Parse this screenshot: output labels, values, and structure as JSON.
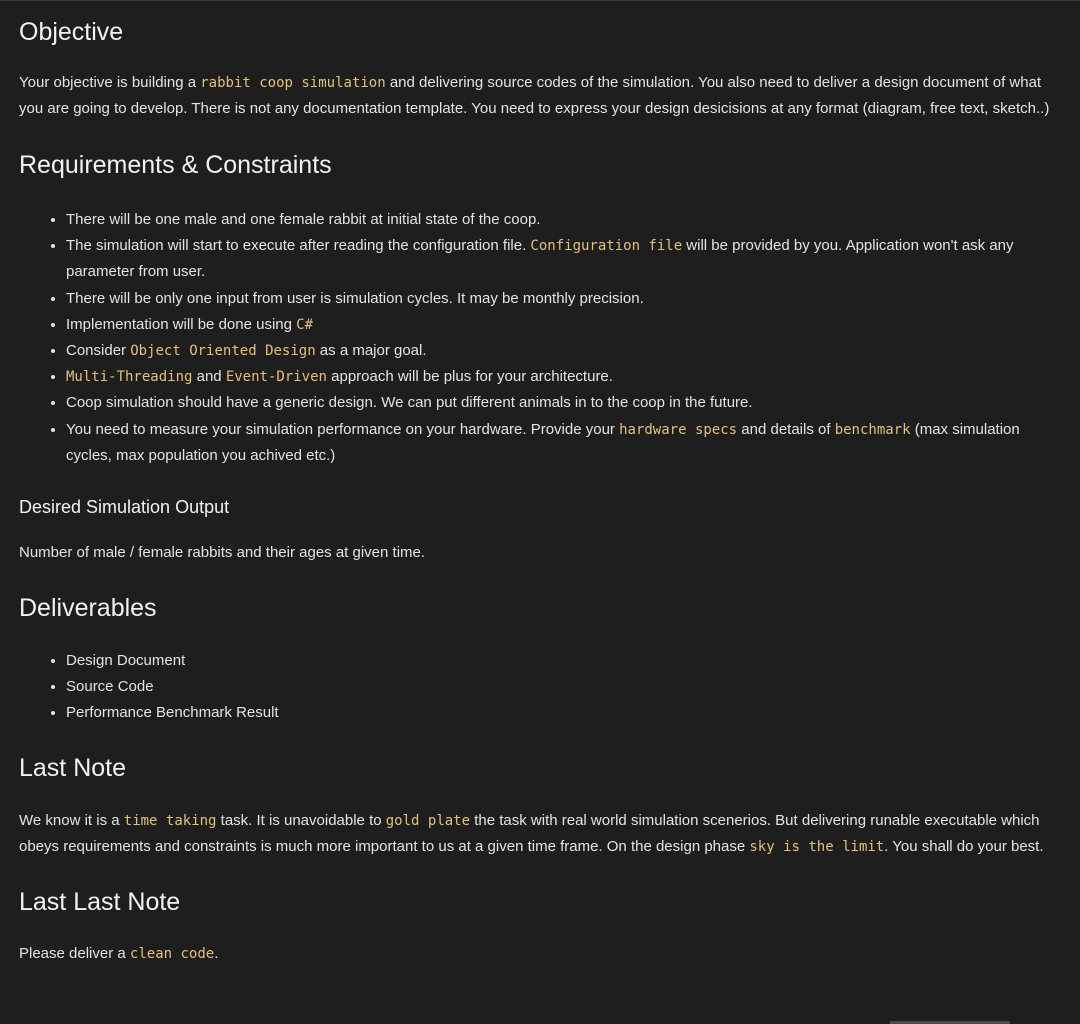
{
  "sections": {
    "objective": {
      "title": "Objective",
      "segments": [
        {
          "t": "Your objective is building a "
        },
        {
          "t": "rabbit coop simulation",
          "code": true
        },
        {
          "t": " and delivering source codes of the simulation. You also need to deliver a design document of what you are going to develop. There is not any documentation template. You need to express your design desicisions at any format (diagram, free text, sketch..)"
        }
      ]
    },
    "requirements": {
      "title": "Requirements & Constraints",
      "items": [
        [
          {
            "t": "There will be one male and one female rabbit at initial state of the coop."
          }
        ],
        [
          {
            "t": "The simulation will start to execute after reading the configuration file. "
          },
          {
            "t": "Configuration file",
            "code": true
          },
          {
            "t": " will be provided by you. Application won't ask any parameter from user."
          }
        ],
        [
          {
            "t": "There will be only one input from user is simulation cycles. It may be monthly precision."
          }
        ],
        [
          {
            "t": "Implementation will be done using "
          },
          {
            "t": "C#",
            "code": true
          }
        ],
        [
          {
            "t": "Consider "
          },
          {
            "t": "Object Oriented Design",
            "code": true
          },
          {
            "t": " as a major goal."
          }
        ],
        [
          {
            "t": "Multi-Threading",
            "code": true
          },
          {
            "t": " and "
          },
          {
            "t": "Event-Driven",
            "code": true
          },
          {
            "t": " approach will be plus for your architecture."
          }
        ],
        [
          {
            "t": "Coop simulation should have a generic design. We can put different animals in to the coop in the future."
          }
        ],
        [
          {
            "t": "You need to measure your simulation performance on your hardware. Provide your "
          },
          {
            "t": "hardware specs",
            "code": true
          },
          {
            "t": " and details of "
          },
          {
            "t": "benchmark",
            "code": true
          },
          {
            "t": " (max simulation cycles, max population you achived etc.)"
          }
        ]
      ]
    },
    "output": {
      "title": "Desired Simulation Output",
      "text": "Number of male / female rabbits and their ages at given time."
    },
    "deliverables": {
      "title": "Deliverables",
      "items": [
        "Design Document",
        "Source Code",
        "Performance Benchmark Result"
      ]
    },
    "last_note": {
      "title": "Last Note",
      "segments": [
        {
          "t": "We know it is a "
        },
        {
          "t": "time taking",
          "code": true
        },
        {
          "t": " task. It is unavoidable to "
        },
        {
          "t": "gold plate",
          "code": true
        },
        {
          "t": " the task with real world simulation scenerios. But delivering runable executable which obeys requirements and constraints is much more important to us at a given time frame. On the design phase "
        },
        {
          "t": "sky is the limit",
          "code": true
        },
        {
          "t": ". You shall do your best."
        }
      ]
    },
    "last_last_note": {
      "title": "Last Last Note",
      "segments": [
        {
          "t": "Please deliver a "
        },
        {
          "t": "clean code",
          "code": true
        },
        {
          "t": "."
        }
      ]
    }
  },
  "colors": {
    "background": "#1e1e1e",
    "text": "#e4e4e4",
    "code": "#e5c07b"
  }
}
